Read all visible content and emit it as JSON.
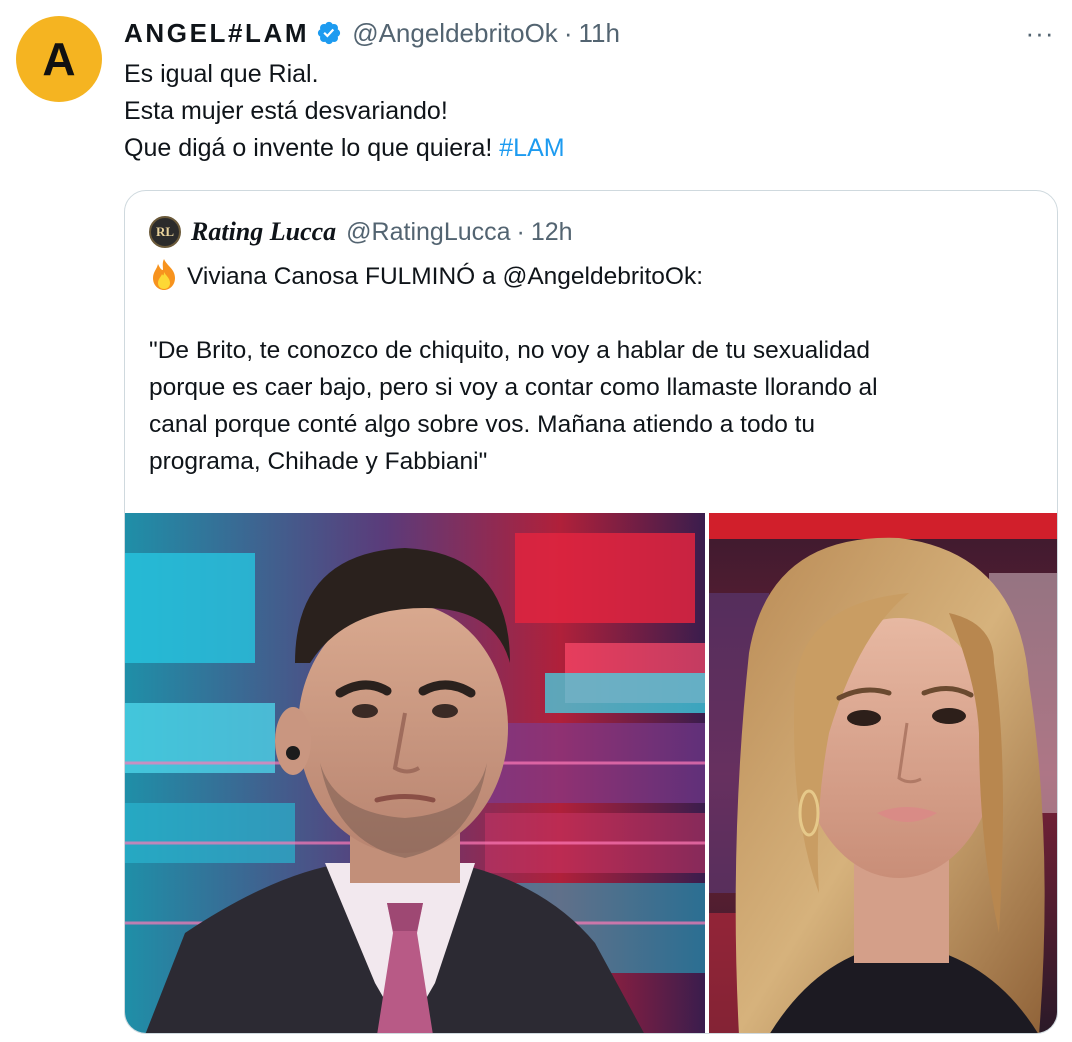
{
  "tweet": {
    "avatar_letter": "A",
    "avatar_color": "#f5b421",
    "display_name": "ANGEL#LAM",
    "handle": "@AngeldebritoOk",
    "separator": "·",
    "time": "11h",
    "more_label": "···",
    "text_lines": [
      "Es igual que Rial.",
      "Esta mujer está desvariando!",
      "Que digá o invente lo que quiera! "
    ],
    "hashtag": "#LAM",
    "accent_color": "#1d9bf0"
  },
  "quote": {
    "display_name": "Rating Lucca",
    "handle": "@RatingLucca",
    "separator": "·",
    "time": "12h",
    "headline": "Viviana Canosa FULMINÓ a @AngeldebritoOk:",
    "body_lines": [
      "\"De Brito, te conozco de chiquito, no voy a hablar de tu sexualidad",
      "porque es caer bajo, pero si voy a contar como llamaste llorando al",
      "canal porque conté algo sobre vos. Mañana atiendo a todo tu",
      "programa, Chihade y Fabbiani\""
    ],
    "fire_icon": "fire-emoji",
    "verified_icon": "verified-badge-icon"
  }
}
